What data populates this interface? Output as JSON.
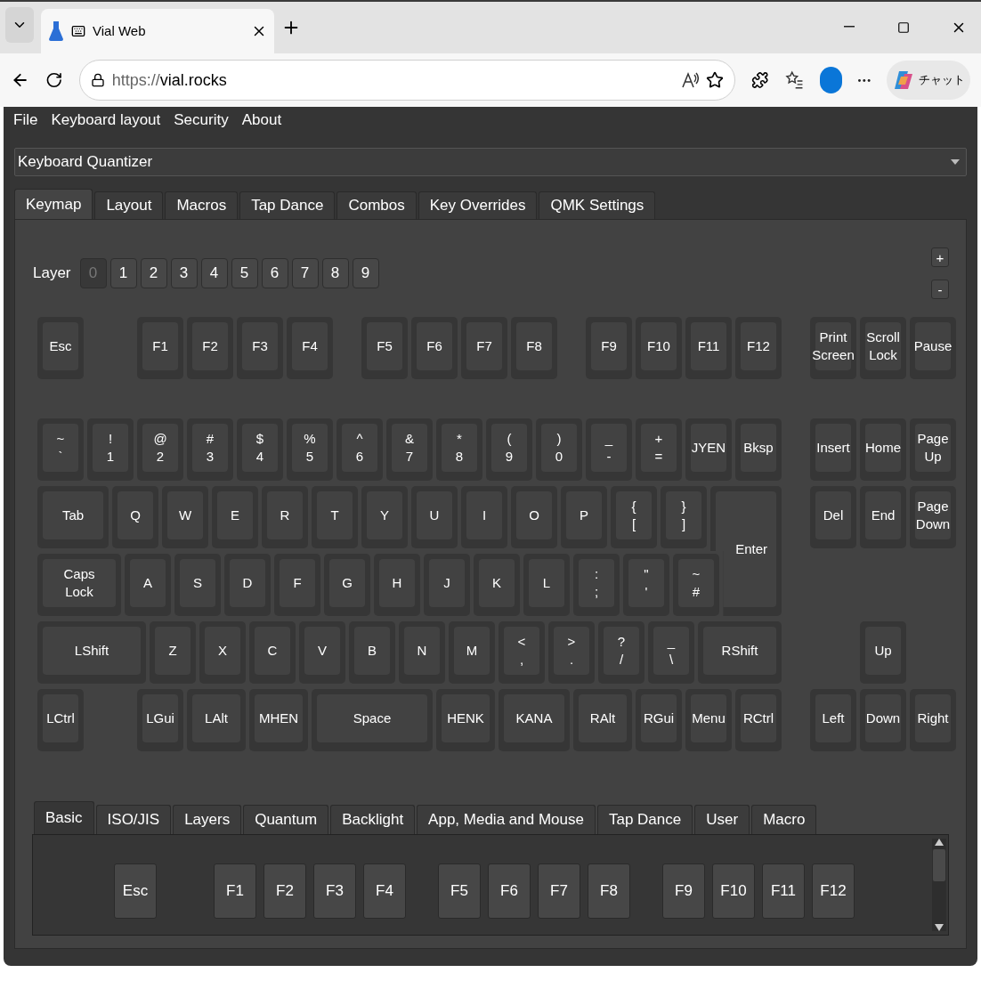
{
  "browser": {
    "tab_title": "Vial Web",
    "url_scheme": "https://",
    "url_host": "vial.rocks",
    "chat_button": "チャット"
  },
  "menu": [
    "File",
    "Keyboard layout",
    "Security",
    "About"
  ],
  "keyboard_select": {
    "value": "Keyboard Quantizer"
  },
  "tabs": [
    {
      "label": "Keymap",
      "selected": true
    },
    {
      "label": "Layout",
      "selected": false
    },
    {
      "label": "Macros",
      "selected": false
    },
    {
      "label": "Tap Dance",
      "selected": false
    },
    {
      "label": "Combos",
      "selected": false
    },
    {
      "label": "Key Overrides",
      "selected": false
    },
    {
      "label": "QMK Settings",
      "selected": false
    }
  ],
  "layer": {
    "label": "Layer",
    "add": "+",
    "remove": "-",
    "buttons": [
      {
        "label": "0",
        "selected": true
      },
      {
        "label": "1",
        "selected": false
      },
      {
        "label": "2",
        "selected": false
      },
      {
        "label": "3",
        "selected": false
      },
      {
        "label": "4",
        "selected": false
      },
      {
        "label": "5",
        "selected": false
      },
      {
        "label": "6",
        "selected": false
      },
      {
        "label": "7",
        "selected": false
      },
      {
        "label": "8",
        "selected": false
      },
      {
        "label": "9",
        "selected": false
      }
    ]
  },
  "keys": [
    {
      "legend": [
        "Esc"
      ]
    },
    {
      "legend": [
        "F1"
      ]
    },
    {
      "legend": [
        "F2"
      ]
    },
    {
      "legend": [
        "F3"
      ]
    },
    {
      "legend": [
        "F4"
      ]
    },
    {
      "legend": [
        "F5"
      ]
    },
    {
      "legend": [
        "F6"
      ]
    },
    {
      "legend": [
        "F7"
      ]
    },
    {
      "legend": [
        "F8"
      ]
    },
    {
      "legend": [
        "F9"
      ]
    },
    {
      "legend": [
        "F10"
      ]
    },
    {
      "legend": [
        "F11"
      ]
    },
    {
      "legend": [
        "F12"
      ]
    },
    {
      "legend": [
        "Print",
        "Screen"
      ]
    },
    {
      "legend": [
        "Scroll",
        "Lock"
      ]
    },
    {
      "legend": [
        "Pause"
      ]
    },
    {
      "legend": [
        "~",
        "`"
      ]
    },
    {
      "legend": [
        "!",
        "1"
      ]
    },
    {
      "legend": [
        "@",
        "2"
      ]
    },
    {
      "legend": [
        "#",
        "3"
      ]
    },
    {
      "legend": [
        "$",
        "4"
      ]
    },
    {
      "legend": [
        "%",
        "5"
      ]
    },
    {
      "legend": [
        "^",
        "6"
      ]
    },
    {
      "legend": [
        "&",
        "7"
      ]
    },
    {
      "legend": [
        "*",
        "8"
      ]
    },
    {
      "legend": [
        "(",
        "9"
      ]
    },
    {
      "legend": [
        ")",
        "0"
      ]
    },
    {
      "legend": [
        "_",
        "-"
      ]
    },
    {
      "legend": [
        "+",
        "="
      ]
    },
    {
      "legend": [
        "JYEN"
      ]
    },
    {
      "legend": [
        "Bksp"
      ]
    },
    {
      "legend": [
        "Insert"
      ]
    },
    {
      "legend": [
        "Home"
      ]
    },
    {
      "legend": [
        "Page",
        "Up"
      ]
    },
    {
      "legend": [
        "Tab"
      ]
    },
    {
      "legend": [
        "Q"
      ]
    },
    {
      "legend": [
        "W"
      ]
    },
    {
      "legend": [
        "E"
      ]
    },
    {
      "legend": [
        "R"
      ]
    },
    {
      "legend": [
        "T"
      ]
    },
    {
      "legend": [
        "Y"
      ]
    },
    {
      "legend": [
        "U"
      ]
    },
    {
      "legend": [
        "I"
      ]
    },
    {
      "legend": [
        "O"
      ]
    },
    {
      "legend": [
        "P"
      ]
    },
    {
      "legend": [
        "{",
        "["
      ]
    },
    {
      "legend": [
        "}",
        "]"
      ]
    },
    {
      "legend": [
        "Enter"
      ]
    },
    {
      "legend": [
        "Del"
      ]
    },
    {
      "legend": [
        "End"
      ]
    },
    {
      "legend": [
        "Page",
        "Down"
      ]
    },
    {
      "legend": [
        "Caps",
        "Lock"
      ]
    },
    {
      "legend": [
        "A"
      ]
    },
    {
      "legend": [
        "S"
      ]
    },
    {
      "legend": [
        "D"
      ]
    },
    {
      "legend": [
        "F"
      ]
    },
    {
      "legend": [
        "G"
      ]
    },
    {
      "legend": [
        "H"
      ]
    },
    {
      "legend": [
        "J"
      ]
    },
    {
      "legend": [
        "K"
      ]
    },
    {
      "legend": [
        "L"
      ]
    },
    {
      "legend": [
        ":",
        ";"
      ]
    },
    {
      "legend": [
        "\"",
        "'"
      ]
    },
    {
      "legend": [
        "~",
        "#"
      ]
    },
    {
      "legend": [
        "LShift"
      ]
    },
    {
      "legend": [
        "Z"
      ]
    },
    {
      "legend": [
        "X"
      ]
    },
    {
      "legend": [
        "C"
      ]
    },
    {
      "legend": [
        "V"
      ]
    },
    {
      "legend": [
        "B"
      ]
    },
    {
      "legend": [
        "N"
      ]
    },
    {
      "legend": [
        "M"
      ]
    },
    {
      "legend": [
        "<",
        ","
      ]
    },
    {
      "legend": [
        ">",
        "."
      ]
    },
    {
      "legend": [
        "?",
        "/"
      ]
    },
    {
      "legend": [
        "_",
        "\\"
      ]
    },
    {
      "legend": [
        "RShift"
      ]
    },
    {
      "legend": [
        "Up"
      ]
    },
    {
      "legend": [
        "LCtrl"
      ]
    },
    {
      "legend": [
        "LGui"
      ]
    },
    {
      "legend": [
        "LAlt"
      ]
    },
    {
      "legend": [
        "MHEN"
      ]
    },
    {
      "legend": [
        "Space"
      ]
    },
    {
      "legend": [
        "HENK"
      ]
    },
    {
      "legend": [
        "KANA"
      ]
    },
    {
      "legend": [
        "RAlt"
      ]
    },
    {
      "legend": [
        "RGui"
      ]
    },
    {
      "legend": [
        "Menu"
      ]
    },
    {
      "legend": [
        "RCtrl"
      ]
    },
    {
      "legend": [
        "Left"
      ]
    },
    {
      "legend": [
        "Down"
      ]
    },
    {
      "legend": [
        "Right"
      ]
    }
  ],
  "keycode_tabs": [
    {
      "label": "Basic",
      "selected": true
    },
    {
      "label": "ISO/JIS",
      "selected": false
    },
    {
      "label": "Layers",
      "selected": false
    },
    {
      "label": "Quantum",
      "selected": false
    },
    {
      "label": "Backlight",
      "selected": false
    },
    {
      "label": "App, Media and Mouse",
      "selected": false
    },
    {
      "label": "Tap Dance",
      "selected": false
    },
    {
      "label": "User",
      "selected": false
    },
    {
      "label": "Macro",
      "selected": false
    }
  ],
  "keycodes": [
    "Esc",
    "F1",
    "F2",
    "F3",
    "F4",
    "F5",
    "F6",
    "F7",
    "F8",
    "F9",
    "F10",
    "F11",
    "F12"
  ]
}
